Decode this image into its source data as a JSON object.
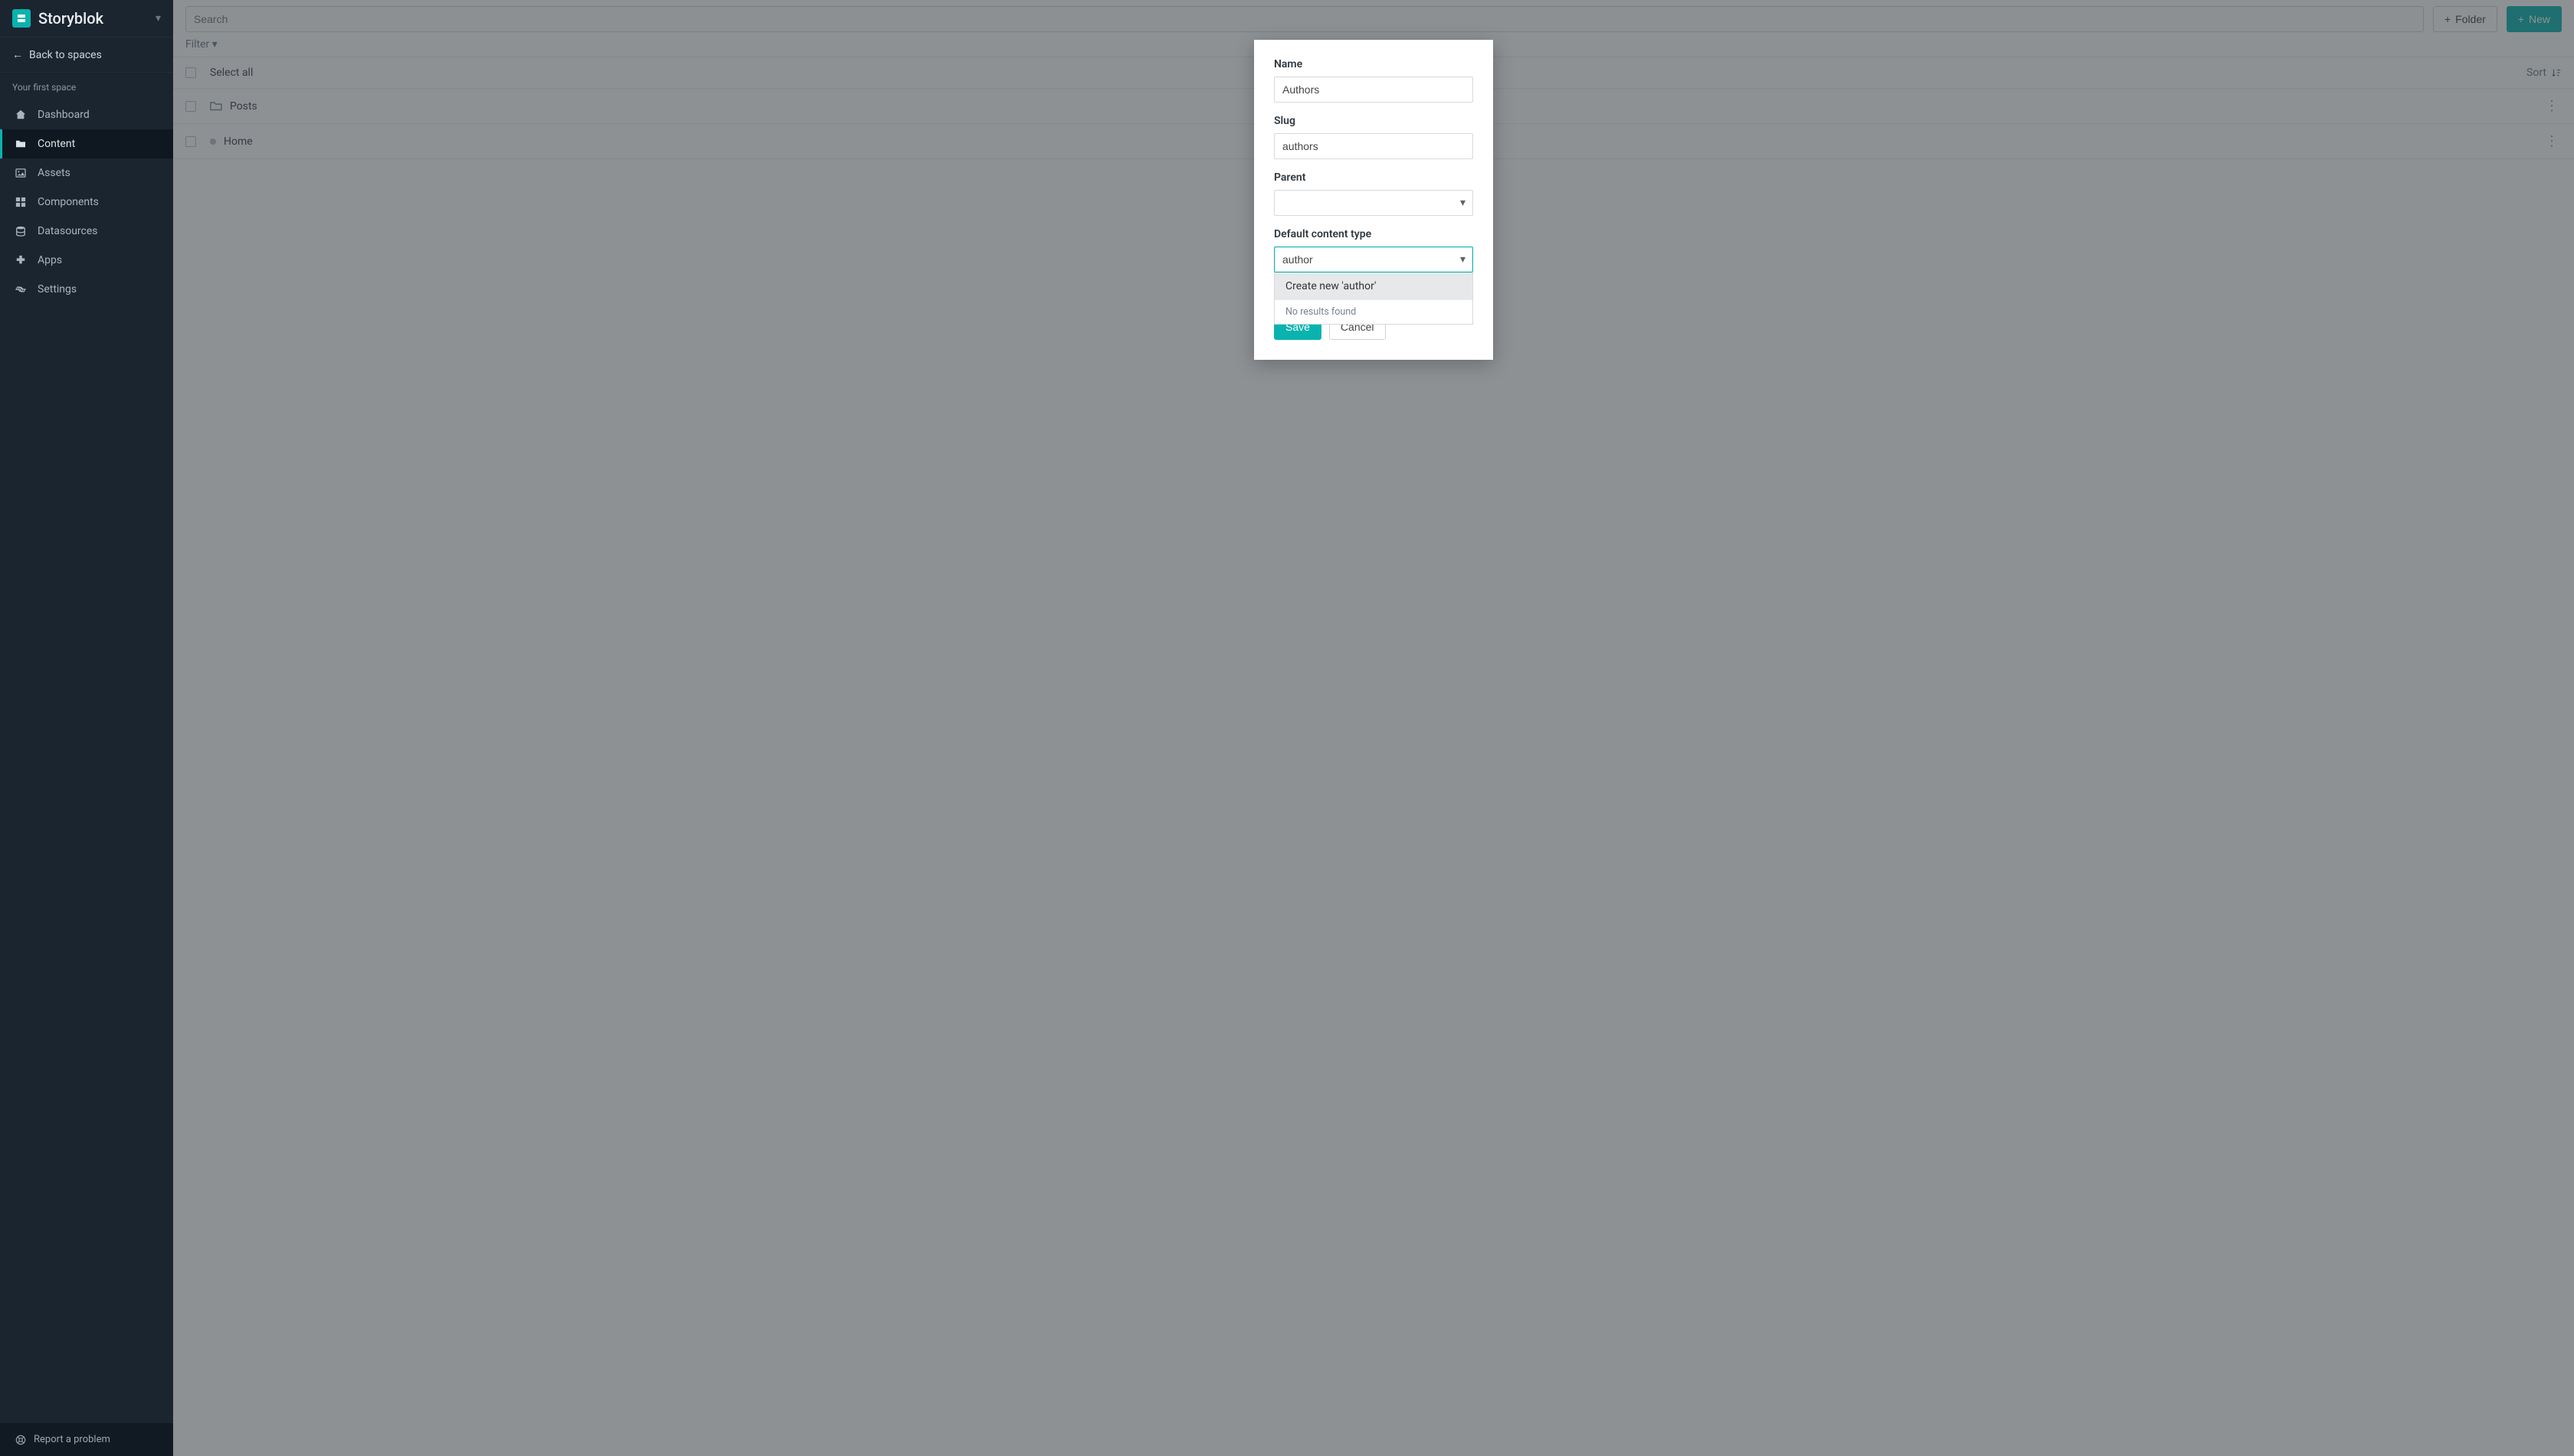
{
  "brand": {
    "name": "Storyblok"
  },
  "sidebar": {
    "back_label": "Back to spaces",
    "space_name": "Your first space",
    "items": [
      {
        "label": "Dashboard"
      },
      {
        "label": "Content"
      },
      {
        "label": "Assets"
      },
      {
        "label": "Components"
      },
      {
        "label": "Datasources"
      },
      {
        "label": "Apps"
      },
      {
        "label": "Settings"
      }
    ],
    "footer_label": "Report a problem"
  },
  "topbar": {
    "search_placeholder": "Search",
    "folder_button": "Folder",
    "new_button": "New"
  },
  "filterbar": {
    "filter_label": "Filter",
    "select_all": "Select all",
    "sort_label": "Sort"
  },
  "content_rows": [
    {
      "title": "Posts",
      "type": "folder"
    },
    {
      "title": "Home",
      "type": "story"
    }
  ],
  "modal": {
    "name_label": "Name",
    "name_value": "Authors",
    "slug_label": "Slug",
    "slug_value": "authors",
    "parent_label": "Parent",
    "parent_value": "",
    "content_type_label": "Default content type",
    "content_type_value": "author",
    "dropdown_create_label": "Create new 'author'",
    "dropdown_no_results": "No results found",
    "save_label": "Save",
    "cancel_label": "Cancel"
  }
}
